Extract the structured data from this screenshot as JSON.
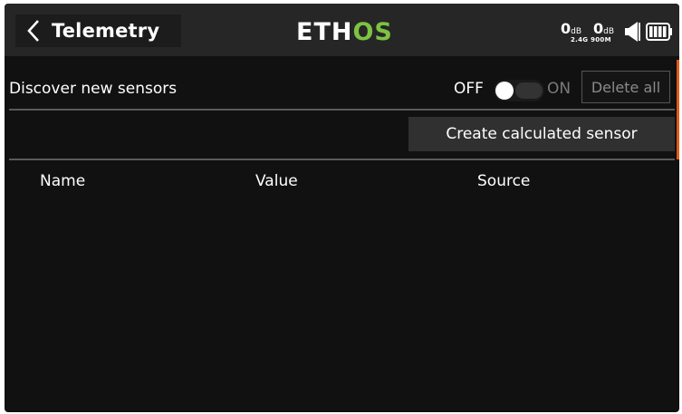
{
  "header": {
    "title": "Telemetry",
    "logo_main": "ETH",
    "logo_accent": "OS",
    "rssi_2g4_value": "0",
    "rssi_2g4_unit": "dB",
    "rssi_900m_value": "0",
    "rssi_900m_unit": "dB",
    "bands_label": "2.4G 900M",
    "icons": [
      "back-chevron-icon",
      "speaker-icon",
      "battery-icon"
    ]
  },
  "discover": {
    "label": "Discover new sensors",
    "toggle_off_label": "OFF",
    "toggle_on_label": "ON",
    "toggle_state": "OFF",
    "delete_all_label": "Delete all"
  },
  "actions": {
    "create_calculated_label": "Create calculated sensor"
  },
  "table": {
    "columns": [
      "Name",
      "Value",
      "Source"
    ],
    "rows": []
  },
  "colors": {
    "background": "#111111",
    "header": "#262626",
    "accent": "#7dc242",
    "scroll_indicator": "#e05a1a"
  }
}
